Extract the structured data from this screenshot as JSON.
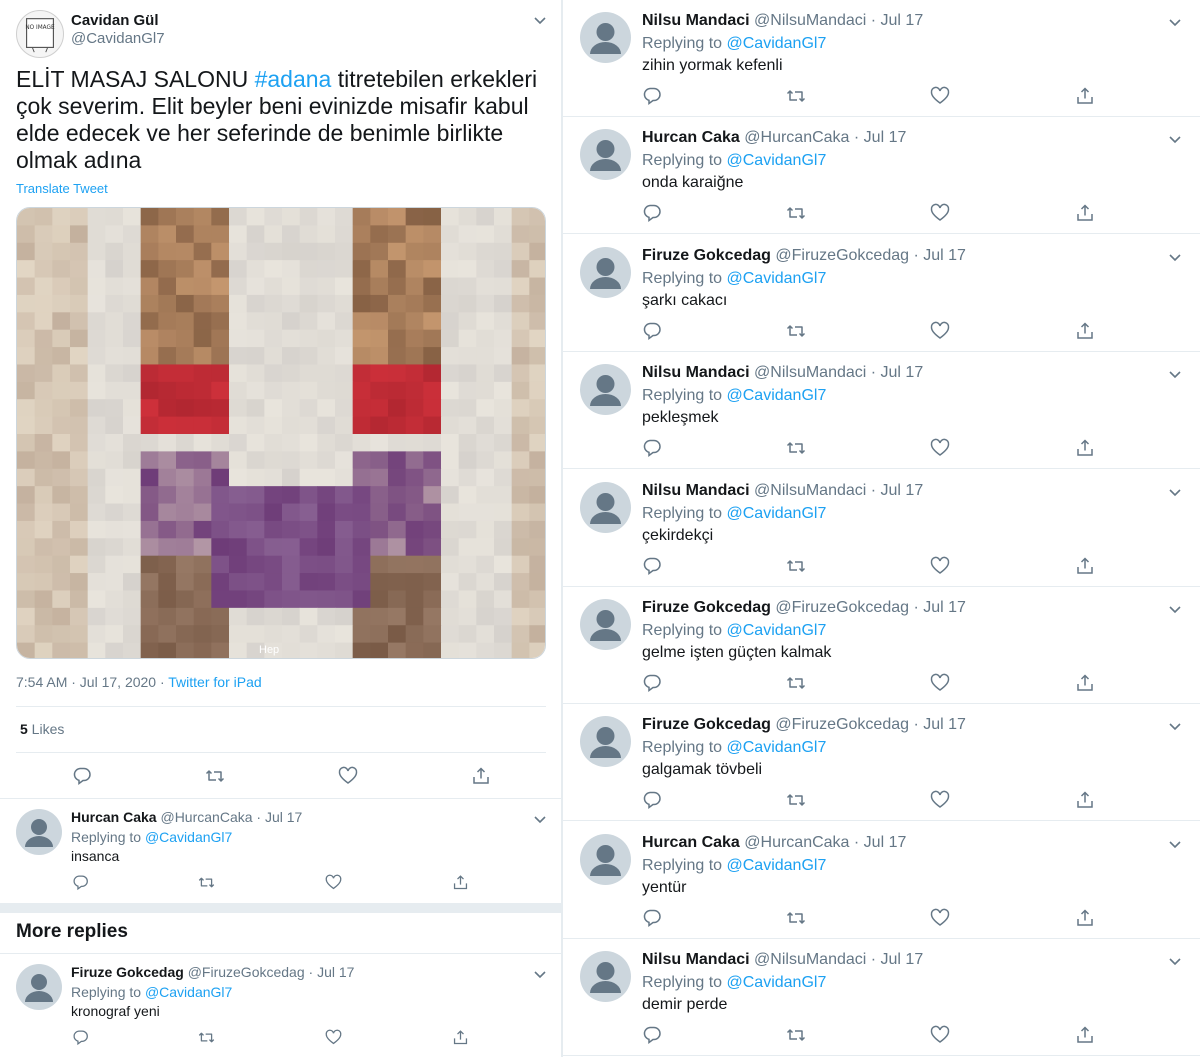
{
  "main_tweet": {
    "author_name": "Cavidan Gül",
    "author_handle": "@CavidanGl7",
    "avatar_text": "NO IMAGE",
    "text_part1": "ELİT MASAJ SALONU ",
    "hashtag": "#adana",
    "text_part2": " titretebilen erkekleri çok severim. Elit beyler beni evinizde misafir kabul elde edecek ve her seferinde de benimle birlikte olmak adına",
    "translate_label": "Translate Tweet",
    "image_watermark": "Hep",
    "timestamp": "7:54 AM · Jul 17, 2020 · ",
    "source": "Twitter for iPad",
    "likes_count": "5",
    "likes_label": " Likes"
  },
  "left_replies": [
    {
      "name": "Hurcan Caka",
      "handle": "@HurcanCaka · Jul 17",
      "replying_label": "Replying to ",
      "replying_to": "@CavidanGl7",
      "text": "insanca"
    },
    {
      "name": "Firuze Gokcedag",
      "handle": "@FiruzeGokcedag · Jul 17",
      "replying_label": "Replying to ",
      "replying_to": "@CavidanGl7",
      "text": "kronograf yeni"
    }
  ],
  "more_replies_label": "More replies",
  "right_replies": [
    {
      "name": "Nilsu Mandaci",
      "handle": "@NilsuMandaci · Jul 17",
      "replying_label": "Replying to ",
      "replying_to": "@CavidanGl7",
      "text": "zihin yormak kefenli"
    },
    {
      "name": "Hurcan Caka",
      "handle": "@HurcanCaka · Jul 17",
      "replying_label": "Replying to ",
      "replying_to": "@CavidanGl7",
      "text": "onda karaiğne"
    },
    {
      "name": "Firuze Gokcedag",
      "handle": "@FiruzeGokcedag · Jul 17",
      "replying_label": "Replying to ",
      "replying_to": "@CavidanGl7",
      "text": "şarkı cakacı"
    },
    {
      "name": "Nilsu Mandaci",
      "handle": "@NilsuMandaci · Jul 17",
      "replying_label": "Replying to ",
      "replying_to": "@CavidanGl7",
      "text": "pekleşmek"
    },
    {
      "name": "Nilsu Mandaci",
      "handle": "@NilsuMandaci · Jul 17",
      "replying_label": "Replying to ",
      "replying_to": "@CavidanGl7",
      "text": "çekirdekçi"
    },
    {
      "name": "Firuze Gokcedag",
      "handle": "@FiruzeGokcedag · Jul 17",
      "replying_label": "Replying to ",
      "replying_to": "@CavidanGl7",
      "text": "gelme işten güçten kalmak"
    },
    {
      "name": "Firuze Gokcedag",
      "handle": "@FiruzeGokcedag · Jul 17",
      "replying_label": "Replying to ",
      "replying_to": "@CavidanGl7",
      "text": "galgamak tövbeli"
    },
    {
      "name": "Hurcan Caka",
      "handle": "@HurcanCaka · Jul 17",
      "replying_label": "Replying to ",
      "replying_to": "@CavidanGl7",
      "text": "yentür"
    },
    {
      "name": "Nilsu Mandaci",
      "handle": "@NilsuMandaci · Jul 17",
      "replying_label": "Replying to ",
      "replying_to": "@CavidanGl7",
      "text": "demir perde"
    }
  ],
  "icons": {
    "reply": "reply-icon",
    "retweet": "retweet-icon",
    "like": "like-icon",
    "share": "share-icon",
    "more": "chevron-down-icon"
  },
  "colors": {
    "link": "#1da1f2",
    "secondary_text": "#657786",
    "divider": "#e6ecf0"
  }
}
